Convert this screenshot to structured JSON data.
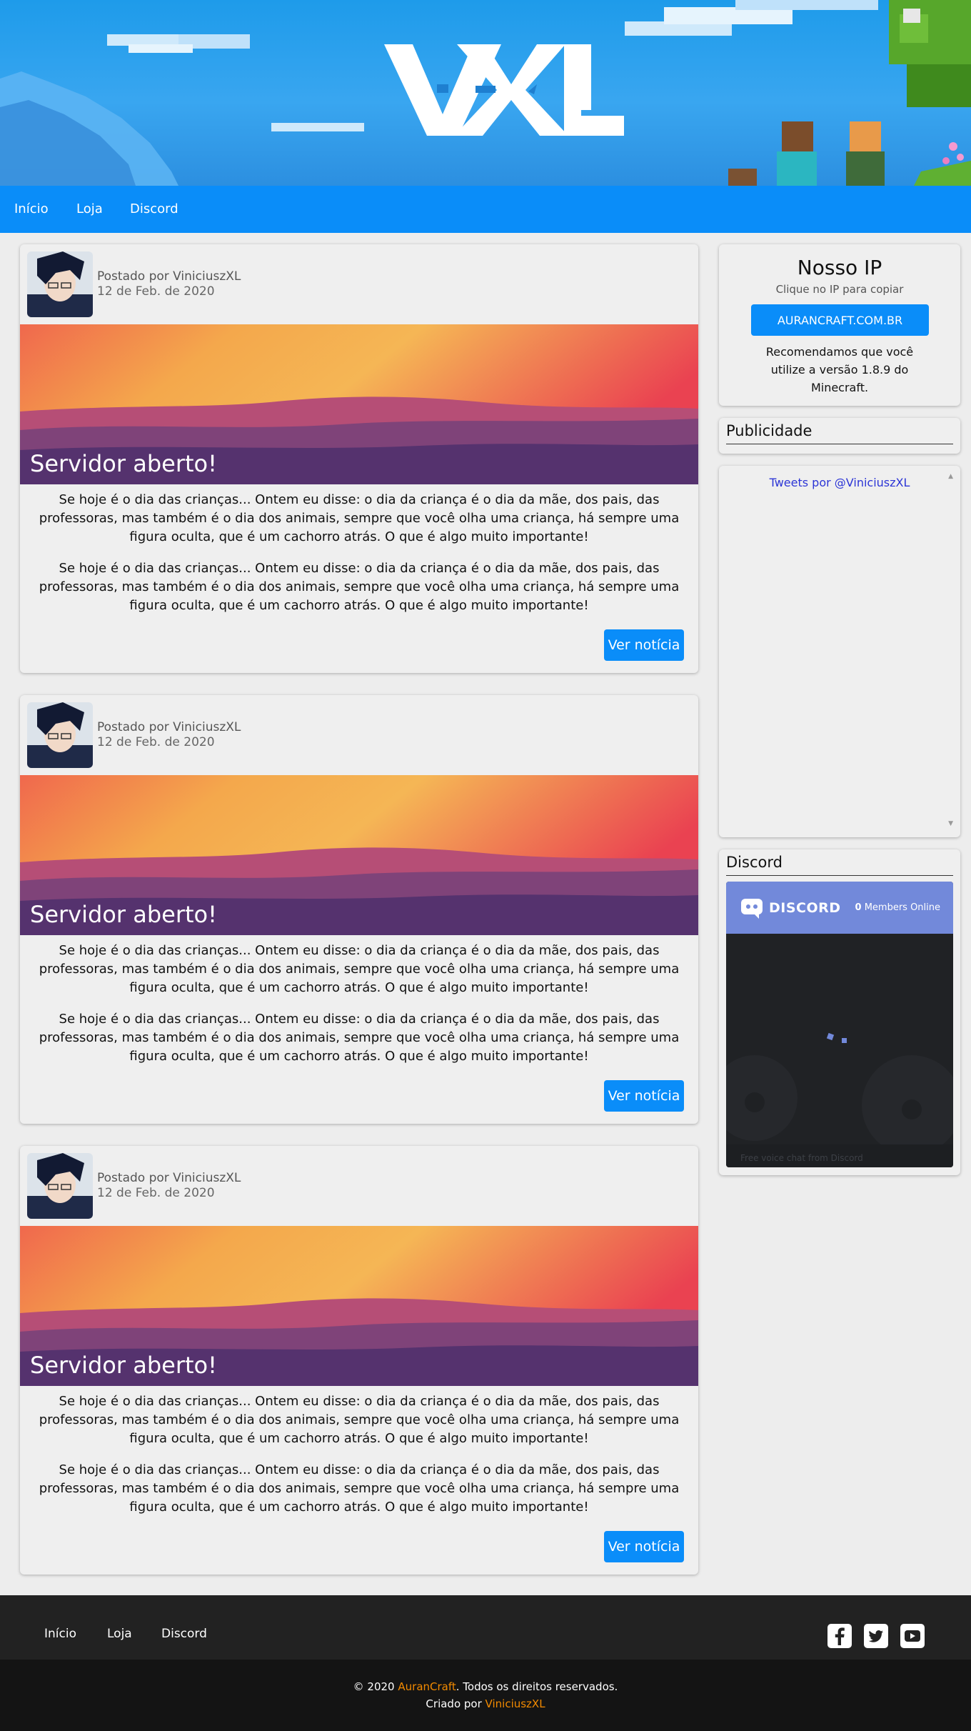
{
  "nav": {
    "items": [
      {
        "label": "Início"
      },
      {
        "label": "Loja"
      },
      {
        "label": "Discord"
      }
    ]
  },
  "posts": [
    {
      "author_prefix": "Postado por",
      "author": "ViniciuszXL",
      "date": "12 de Feb. de 2020",
      "title": "Servidor aberto!",
      "paragraph1": "Se hoje é o dia das crianças... Ontem eu disse: o dia da criança é o dia da mãe, dos pais, das professoras, mas também é o dia dos animais, sempre que você olha uma criança, há sempre uma figura oculta, que é um cachorro atrás. O que é algo muito importante!",
      "paragraph2": "Se hoje é o dia das crianças... Ontem eu disse: o dia da criança é o dia da mãe, dos pais, das professoras, mas também é o dia dos animais, sempre que você olha uma criança, há sempre uma figura oculta, que é um cachorro atrás. O que é algo muito importante!",
      "button": "Ver notícia"
    },
    {
      "author_prefix": "Postado por",
      "author": "ViniciuszXL",
      "date": "12 de Feb. de 2020",
      "title": "Servidor aberto!",
      "paragraph1": "Se hoje é o dia das crianças... Ontem eu disse: o dia da criança é o dia da mãe, dos pais, das professoras, mas também é o dia dos animais, sempre que você olha uma criança, há sempre uma figura oculta, que é um cachorro atrás. O que é algo muito importante!",
      "paragraph2": "Se hoje é o dia das crianças... Ontem eu disse: o dia da criança é o dia da mãe, dos pais, das professoras, mas também é o dia dos animais, sempre que você olha uma criança, há sempre uma figura oculta, que é um cachorro atrás. O que é algo muito importante!",
      "button": "Ver notícia"
    },
    {
      "author_prefix": "Postado por",
      "author": "ViniciuszXL",
      "date": "12 de Feb. de 2020",
      "title": "Servidor aberto!",
      "paragraph1": "Se hoje é o dia das crianças... Ontem eu disse: o dia da criança é o dia da mãe, dos pais, das professoras, mas também é o dia dos animais, sempre que você olha uma criança, há sempre uma figura oculta, que é um cachorro atrás. O que é algo muito importante!",
      "paragraph2": "Se hoje é o dia das crianças... Ontem eu disse: o dia da criança é o dia da mãe, dos pais, das professoras, mas também é o dia dos animais, sempre que você olha uma criança, há sempre uma figura oculta, que é um cachorro atrás. O que é algo muito importante!",
      "button": "Ver notícia"
    }
  ],
  "sidebar": {
    "ip": {
      "title": "Nosso IP",
      "subtitle": "Clique no IP para copiar",
      "address": "AURANCRAFT.COM.BR",
      "recommendation": "Recomendamos que você utilize a versão 1.8.9 do Minecraft."
    },
    "ads": {
      "title": "Publicidade"
    },
    "tweets": {
      "link": "Tweets por @ViniciuszXL"
    },
    "discord": {
      "title": "Discord",
      "brand": "DISCORD",
      "members_count": "0",
      "members_label": "Members Online",
      "footer": "Free voice chat from Discord"
    }
  },
  "footer": {
    "links": [
      {
        "label": "Início"
      },
      {
        "label": "Loja"
      },
      {
        "label": "Discord"
      }
    ],
    "social": [
      "facebook-icon",
      "twitter-icon",
      "youtube-icon"
    ],
    "copy_prefix": "© 2020",
    "brand": "AuranCraft",
    "copy_suffix": ". Todos os direitos reservados.",
    "created_prefix": "Criado por",
    "creator": "ViniciuszXL"
  },
  "colors": {
    "accent": "#0a8df9",
    "footer_highlight": "#f28a00",
    "discord": "#7289da"
  }
}
